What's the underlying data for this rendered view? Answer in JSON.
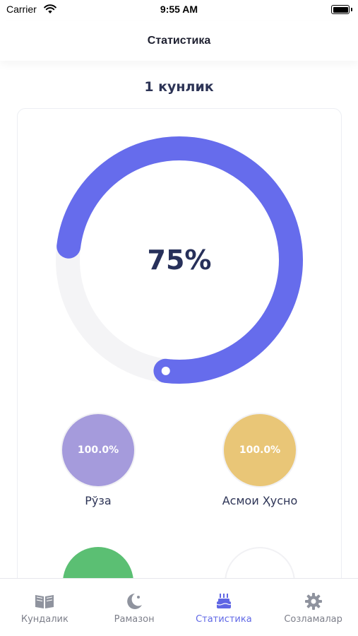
{
  "status_bar": {
    "carrier": "Carrier",
    "time": "9:55 AM"
  },
  "header": {
    "title": "Статистика"
  },
  "period": {
    "title": "1 кунлик"
  },
  "progress": {
    "value_label": "75%",
    "fraction": 0.75,
    "color": "#666cec",
    "track_color": "#f4f4f6"
  },
  "stats": [
    {
      "value": "100.0%",
      "label": "Рўза",
      "color": "#a59bdc"
    },
    {
      "value": "100.0%",
      "label": "Асмои Ҳусно",
      "color": "#e9c677"
    }
  ],
  "partial_row": [
    {
      "color": "#5bbf73"
    },
    {
      "color": "#ffffff"
    }
  ],
  "tabs": [
    {
      "label": "Кундалик",
      "icon": "book-icon",
      "active": false
    },
    {
      "label": "Рамазон",
      "icon": "moon-icon",
      "active": false
    },
    {
      "label": "Статистика",
      "icon": "cake-icon",
      "active": true
    },
    {
      "label": "Созламалар",
      "icon": "gear-icon",
      "active": false
    }
  ],
  "colors": {
    "accent": "#666cec",
    "text_dark": "#2d3456",
    "inactive": "#7d7f8a"
  }
}
